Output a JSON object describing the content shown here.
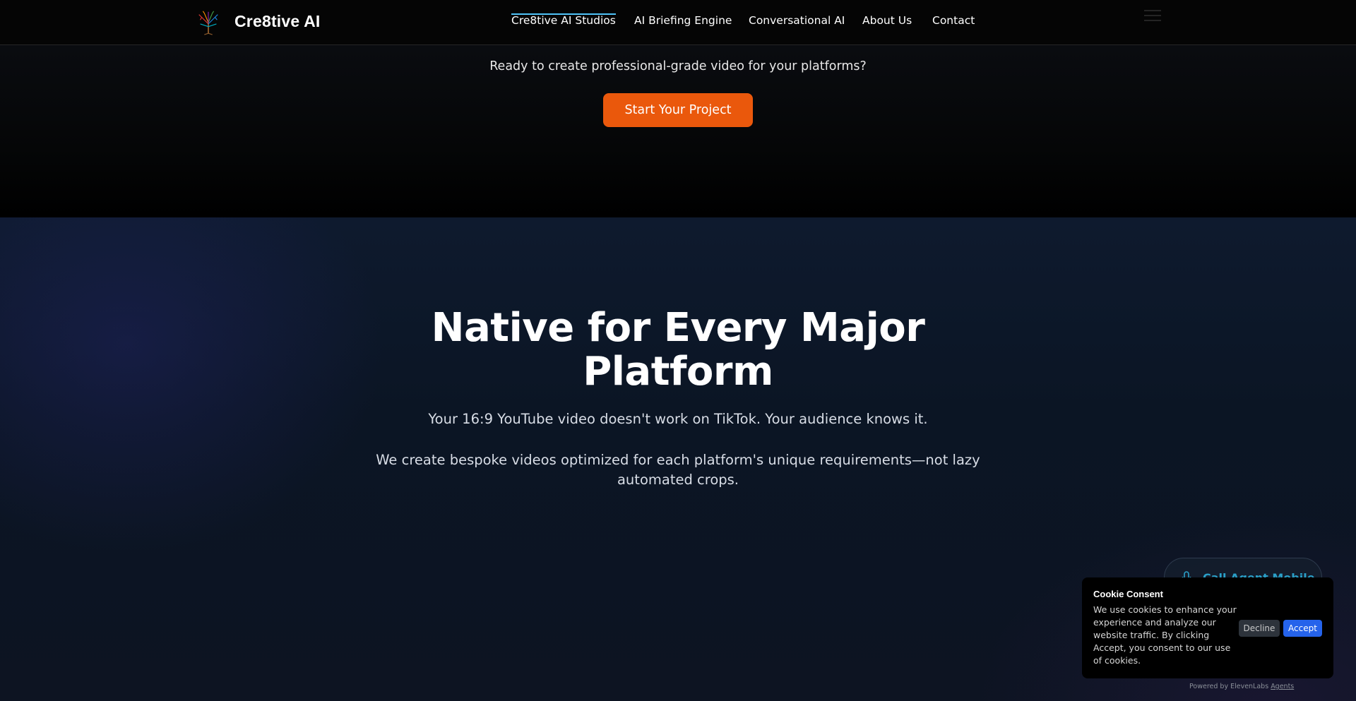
{
  "header": {
    "brand": "Cre8tive AI",
    "logo_icon": "tree-logo-icon",
    "nav": [
      {
        "label": "Cre8tive AI Studios",
        "active": true
      },
      {
        "label": "AI Briefing Engine",
        "active": false
      },
      {
        "label": "Conversational AI",
        "active": false
      },
      {
        "label": "About Us",
        "active": false
      },
      {
        "label": "Contact",
        "active": false
      }
    ],
    "active_color": "#4fc3f7"
  },
  "cta": {
    "text": "Ready to create professional-grade video for your platforms?",
    "button_label": "Start Your Project",
    "button_color": "#ea580c"
  },
  "platforms": {
    "title_line1": "Native for Every Major",
    "title_line2": "Platform",
    "subtitle": "Your 16:9 YouTube video doesn't work on TikTok. Your audience knows it.",
    "description": "We create bespoke videos optimized for each platform's unique requirements—not lazy automated crops."
  },
  "call_agent": {
    "label": "Call Agent Mobile",
    "icon": "microphone-icon",
    "color": "#2aa0c8"
  },
  "cookie": {
    "title": "Cookie Consent",
    "body": "We use cookies to enhance your experience and analyze our website traffic. By clicking Accept, you consent to our use of cookies.",
    "decline_label": "Decline",
    "accept_label": "Accept",
    "accept_color": "#2563eb"
  },
  "footer": {
    "powered_prefix": "Powered by ElevenLabs",
    "powered_link": "Agents"
  }
}
